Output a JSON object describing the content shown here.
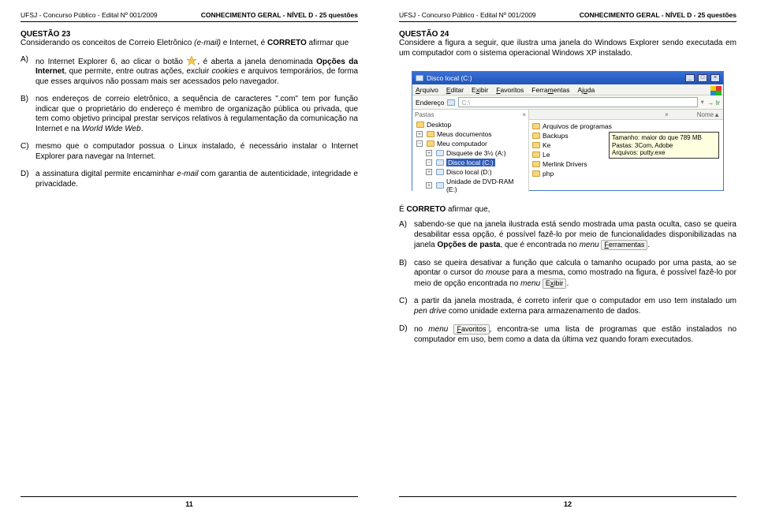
{
  "header": {
    "left": "UFSJ - Concurso Público - Edital Nº 001/2009",
    "right": "CONHECIMENTO GERAL - NÍVEL D - 25 questões"
  },
  "page_left_num": "11",
  "page_right_num": "12",
  "q23": {
    "title": "QUESTÃO 23",
    "stem_pre": "Considerando os conceitos de Correio Eletrônico ",
    "stem_em": "(e-mail)",
    "stem_mid": " e Internet, é ",
    "stem_bold": "CORRETO",
    "stem_post": " afirmar que",
    "a_pre": "no Internet Explorer 6, ao clicar o botão ",
    "a_mid": ", é aberta a janela denominada ",
    "a_bold": "Opções da Internet",
    "a_post1": ", que permite, entre outras ações, excluir ",
    "a_em": "cookies",
    "a_post2": " e arquivos temporários, de forma que esses arquivos não possam mais ser acessados pelo navegador.",
    "b_pre": "nos endereços de correio eletrônico, a sequência de caracteres \".com\" tem por função indicar que o proprietário do endereço é membro de organização pública ou privada, que tem como objetivo principal prestar serviços relativos à regulamentação da comunicação na Internet e na ",
    "b_em": "World Wide Web",
    "b_post": ".",
    "c": "mesmo que o computador possua o Linux instalado, é necessário instalar o Internet Explorer para navegar na Internet.",
    "d_pre": "a assinatura digital permite encaminhar ",
    "d_em": "e-mail",
    "d_post": " com garantia de autenticidade, integridade e privacidade."
  },
  "q24": {
    "title": "QUESTÃO 24",
    "stem": "Considere a figura a seguir, que ilustra uma janela do Windows Explorer sendo executada em um computador com o sistema operacional Windows XP instalado.",
    "prompt_pre": "É ",
    "prompt_bold": "CORRETO",
    "prompt_post": " afirmar que,",
    "a_pre": "sabendo-se que na janela ilustrada está sendo mostrada uma pasta oculta, caso se queira desabilitar essa opção, é possível fazê-lo por meio de funcionalidades disponibilizadas na janela ",
    "a_bold": "Opções de pasta",
    "a_mid": ", que é encontrada no ",
    "a_em": "menu",
    "a_menu": "Ferramentas",
    "a_post": ".",
    "b_pre": "caso se queira desativar a função que calcula o tamanho ocupado por uma pasta, ao se apontar o cursor do ",
    "b_em1": "mouse",
    "b_mid": " para a mesma, como mostrado na figura, é possível fazê-lo por meio de opção encontrada no ",
    "b_em2": "menu",
    "b_menu": "Exibir",
    "b_post": ".",
    "c_pre": "a partir da janela mostrada, é correto inferir que o computador em uso tem instalado um ",
    "c_em": "pen drive",
    "c_post": " como unidade externa para armazenamento de dados.",
    "d_pre": "no ",
    "d_em": "menu",
    "d_menu": "Favoritos",
    "d_post": ", encontra-se uma lista de programas que estão instalados no computador em uso, bem como a data da última vez quando foram executados."
  },
  "explorer": {
    "title": "Disco local (C:)",
    "menus": [
      "Arquivo",
      "Editar",
      "Exibir",
      "Favoritos",
      "Ferramentas",
      "Ajuda"
    ],
    "address_label": "Endereço",
    "address_value": "C:\\",
    "go": "Ir",
    "left_pane_label": "Pastas",
    "left_items": [
      {
        "label": "Desktop",
        "type": "fld"
      },
      {
        "label": "Meus documentos",
        "type": "fld",
        "plus": true
      },
      {
        "label": "Meu computador",
        "type": "fld",
        "plus": false
      },
      {
        "label": "Disquete de 3½ (A:)",
        "type": "drv",
        "plus": true,
        "indent": true
      },
      {
        "label": "Disco local (C:)",
        "type": "drv",
        "plus": false,
        "indent": true,
        "sel": true
      },
      {
        "label": "Disco local (D:)",
        "type": "drv",
        "plus": true,
        "indent": true
      },
      {
        "label": "Unidade de DVD-RAM (E:)",
        "type": "drv",
        "plus": true,
        "indent": true
      }
    ],
    "col_nome": "Nome",
    "right_items": [
      "Arquivos de programas",
      "Backups",
      "Ke",
      "Le",
      "Merlink Drivers",
      "php"
    ],
    "tooltip_l1": "Tamanho: maior do que 789 MB",
    "tooltip_l2": "Pastas: 3Com, Adobe",
    "tooltip_l3": "Arquivos: putty.exe"
  }
}
